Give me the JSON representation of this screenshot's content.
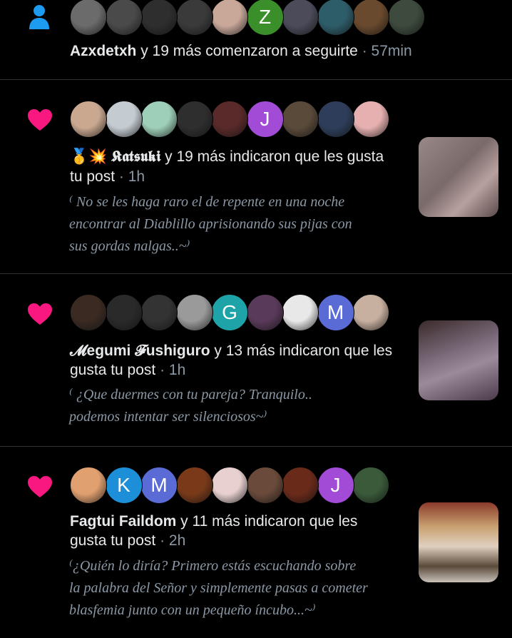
{
  "notifications": [
    {
      "type": "follow",
      "icon": "person-icon",
      "avatars": [
        {
          "kind": "image",
          "color": "#6b6b6b"
        },
        {
          "kind": "image",
          "color": "#4a4a4a"
        },
        {
          "kind": "image",
          "color": "#2e2e2e"
        },
        {
          "kind": "image",
          "color": "#3a3a3a"
        },
        {
          "kind": "image",
          "color": "#c9a89a"
        },
        {
          "kind": "letter",
          "letter": "Z",
          "color": "#3a8f2a"
        },
        {
          "kind": "image",
          "color": "#4b4b5a"
        },
        {
          "kind": "image",
          "color": "#2e5d6a"
        },
        {
          "kind": "image",
          "color": "#6a4a2e"
        },
        {
          "kind": "image",
          "color": "#3e4a3e"
        }
      ],
      "user": "Azxdetxh",
      "action": " y 19 más comenzaron a seguirte",
      "time": " · 57min"
    },
    {
      "type": "like",
      "icon": "heart-icon",
      "avatars": [
        {
          "kind": "image",
          "color": "#caa890"
        },
        {
          "kind": "image",
          "color": "#c4cbd1"
        },
        {
          "kind": "image",
          "color": "#9ecfb8"
        },
        {
          "kind": "image",
          "color": "#2e2e2e"
        },
        {
          "kind": "image",
          "color": "#5a2a2a"
        },
        {
          "kind": "letter",
          "letter": "J",
          "color": "#a24bd6"
        },
        {
          "kind": "image",
          "color": "#5a4a3a"
        },
        {
          "kind": "image",
          "color": "#2e3e5a"
        },
        {
          "kind": "image",
          "color": "#e6b0b0"
        }
      ],
      "user": "🥇💥 𝕶𝖆𝖙𝖘𝖚𝖐𝖎",
      "action": " y 19 más indicaron que les gusta",
      "action2": "tu post",
      "time": " · 1h",
      "quote_lines": [
        "⁽ No se les haga raro el de repente en una noche",
        "encontrar al Diablillo aprisionando sus pijas con",
        "sus gordas nalgas..~⁾"
      ],
      "thumb_color": "#8a7878"
    },
    {
      "type": "like",
      "icon": "heart-icon",
      "avatars": [
        {
          "kind": "image",
          "color": "#3a2a22"
        },
        {
          "kind": "image",
          "color": "#2a2a2a"
        },
        {
          "kind": "image",
          "color": "#333333"
        },
        {
          "kind": "image",
          "color": "#9a9a9a"
        },
        {
          "kind": "letter",
          "letter": "G",
          "color": "#1ea3a8"
        },
        {
          "kind": "image",
          "color": "#5a3a5a"
        },
        {
          "kind": "image",
          "color": "#e8e8e8"
        },
        {
          "kind": "letter",
          "letter": "M",
          "color": "#5a6bd6"
        },
        {
          "kind": "image",
          "color": "#c8b0a0"
        }
      ],
      "user": "𝓜egumi 𝓕ushiguro",
      "action": " y 13 más indicaron que les",
      "action2": "gusta tu post",
      "time": " · 1h",
      "quote_lines": [
        "⁽ ¿Que duermes con tu pareja? Tranquilo..",
        "podemos intentar ser silenciosos~⁾"
      ],
      "thumb_color": "#6a5a6a"
    },
    {
      "type": "like",
      "icon": "heart-icon",
      "avatars": [
        {
          "kind": "image",
          "color": "#e0a070"
        },
        {
          "kind": "letter",
          "letter": "K",
          "color": "#1d8fd8"
        },
        {
          "kind": "letter",
          "letter": "M",
          "color": "#5a6bd6"
        },
        {
          "kind": "image",
          "color": "#7a3a1a"
        },
        {
          "kind": "image",
          "color": "#e8d0d0"
        },
        {
          "kind": "image",
          "color": "#6a4a3a"
        },
        {
          "kind": "image",
          "color": "#6a2a1a"
        },
        {
          "kind": "letter",
          "letter": "J",
          "color": "#a24bd6"
        },
        {
          "kind": "image",
          "color": "#3a5a3a"
        }
      ],
      "user": "Fagtui Faildom",
      "action": " y 11 más indicaron que les",
      "action2": "gusta tu post",
      "time": " · 2h",
      "quote_lines": [
        "⁽¿Quién lo diría? Primero estás escuchando sobre",
        "la palabra del Señor y simplemente pasas a cometer",
        "blasfemia  junto con un pequeño íncubo...~⁾"
      ],
      "thumb_color": "#c8a890"
    }
  ]
}
